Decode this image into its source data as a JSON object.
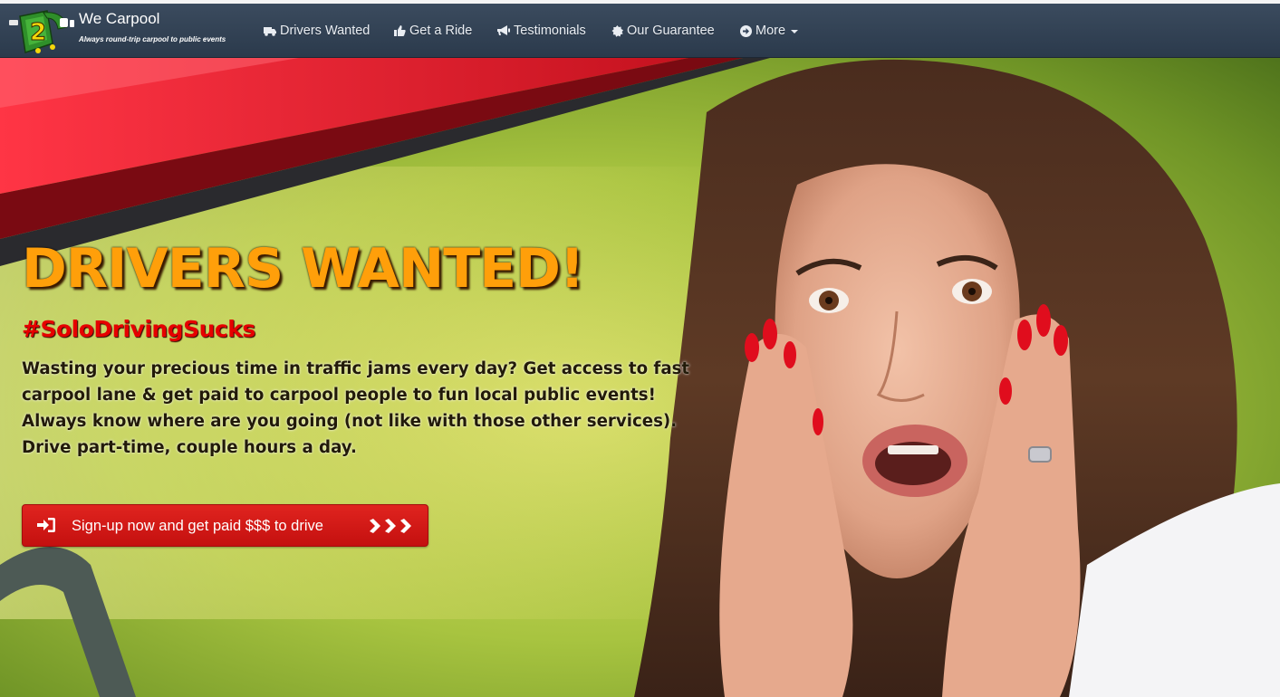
{
  "brand": {
    "name": "We Carpool",
    "tagline": "Always round-trip carpool to public events"
  },
  "nav": {
    "items": [
      {
        "label": "Drivers Wanted",
        "icon": "truck-icon"
      },
      {
        "label": "Get a Ride",
        "icon": "thumbs-up-icon"
      },
      {
        "label": "Testimonials",
        "icon": "bullhorn-icon"
      },
      {
        "label": "Our Guarantee",
        "icon": "certificate-icon"
      },
      {
        "label": "More",
        "icon": "circle-arrow-right-icon"
      }
    ]
  },
  "hero": {
    "headline": "DRIVERS WANTED!",
    "hashtag": "#SoloDrivingSucks",
    "pitch": "Wasting your precious time in traffic jams every day? Get access to fast carpool lane & get paid to carpool people to fun local public events! Always know where are you going (not like with those other services). Drive part-time, couple hours a day.",
    "cta_label": "Sign-up now and get paid $$$ to drive",
    "cta_icon": "sign-in-icon",
    "cta_trailing_icon": "triple-chevron-right-icon"
  },
  "colors": {
    "navbar": "#34445a",
    "headline": "#ff9f0a",
    "hashtag": "#e60000",
    "cta": "#d31a17"
  }
}
